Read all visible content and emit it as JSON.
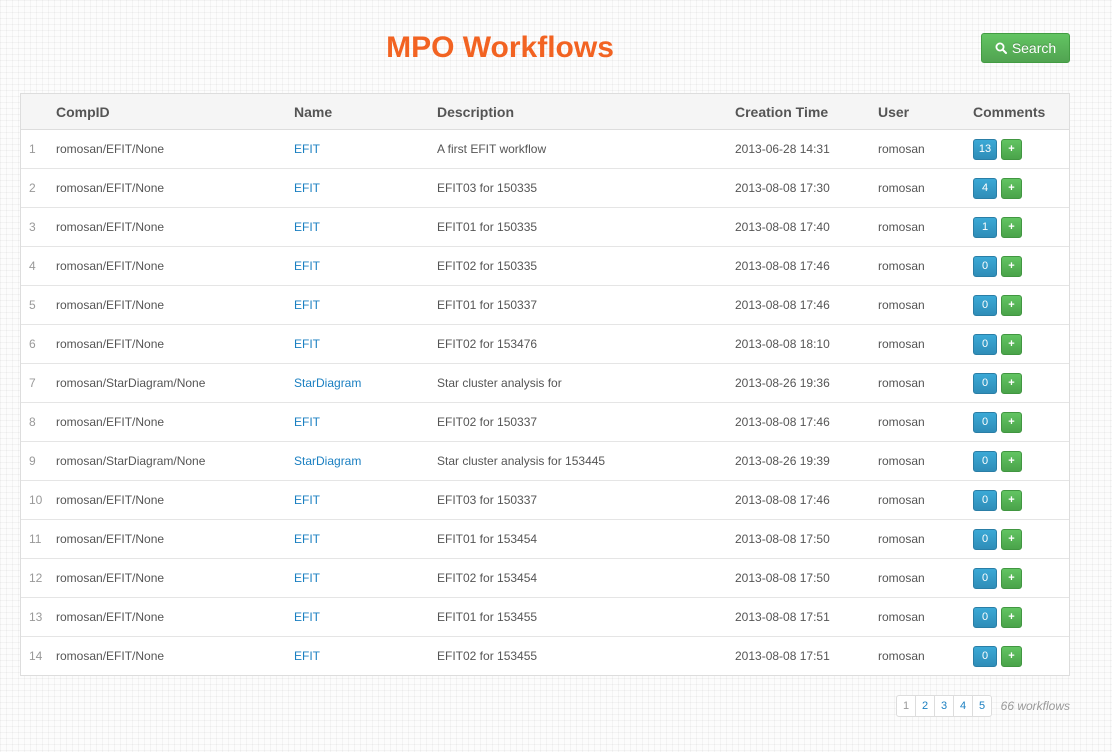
{
  "page": {
    "title": "MPO Workflows"
  },
  "toolbar": {
    "search_label": "Search",
    "search_icon": "search-icon"
  },
  "table": {
    "columns": [
      "",
      "CompID",
      "Name",
      "Description",
      "Creation Time",
      "User",
      "Comments"
    ],
    "rows": [
      {
        "index": "1",
        "compid": "romosan/EFIT/None",
        "name": "EFIT",
        "description": "A first EFIT workflow",
        "time": "2013-06-28 14:31",
        "user": "romosan",
        "comments": "13"
      },
      {
        "index": "2",
        "compid": "romosan/EFIT/None",
        "name": "EFIT",
        "description": "EFIT03 for 150335",
        "time": "2013-08-08 17:30",
        "user": "romosan",
        "comments": "4"
      },
      {
        "index": "3",
        "compid": "romosan/EFIT/None",
        "name": "EFIT",
        "description": "EFIT01 for 150335",
        "time": "2013-08-08 17:40",
        "user": "romosan",
        "comments": "1"
      },
      {
        "index": "4",
        "compid": "romosan/EFIT/None",
        "name": "EFIT",
        "description": "EFIT02 for 150335",
        "time": "2013-08-08 17:46",
        "user": "romosan",
        "comments": "0"
      },
      {
        "index": "5",
        "compid": "romosan/EFIT/None",
        "name": "EFIT",
        "description": "EFIT01 for 150337",
        "time": "2013-08-08 17:46",
        "user": "romosan",
        "comments": "0"
      },
      {
        "index": "6",
        "compid": "romosan/EFIT/None",
        "name": "EFIT",
        "description": "EFIT02 for 153476",
        "time": "2013-08-08 18:10",
        "user": "romosan",
        "comments": "0"
      },
      {
        "index": "7",
        "compid": "romosan/StarDiagram/None",
        "name": "StarDiagram",
        "description": "Star cluster analysis for",
        "time": "2013-08-26 19:36",
        "user": "romosan",
        "comments": "0"
      },
      {
        "index": "8",
        "compid": "romosan/EFIT/None",
        "name": "EFIT",
        "description": "EFIT02 for 150337",
        "time": "2013-08-08 17:46",
        "user": "romosan",
        "comments": "0"
      },
      {
        "index": "9",
        "compid": "romosan/StarDiagram/None",
        "name": "StarDiagram",
        "description": "Star cluster analysis for 153445",
        "time": "2013-08-26 19:39",
        "user": "romosan",
        "comments": "0"
      },
      {
        "index": "10",
        "compid": "romosan/EFIT/None",
        "name": "EFIT",
        "description": "EFIT03 for 150337",
        "time": "2013-08-08 17:46",
        "user": "romosan",
        "comments": "0"
      },
      {
        "index": "11",
        "compid": "romosan/EFIT/None",
        "name": "EFIT",
        "description": "EFIT01 for 153454",
        "time": "2013-08-08 17:50",
        "user": "romosan",
        "comments": "0"
      },
      {
        "index": "12",
        "compid": "romosan/EFIT/None",
        "name": "EFIT",
        "description": "EFIT02 for 153454",
        "time": "2013-08-08 17:50",
        "user": "romosan",
        "comments": "0"
      },
      {
        "index": "13",
        "compid": "romosan/EFIT/None",
        "name": "EFIT",
        "description": "EFIT01 for 153455",
        "time": "2013-08-08 17:51",
        "user": "romosan",
        "comments": "0"
      },
      {
        "index": "14",
        "compid": "romosan/EFIT/None",
        "name": "EFIT",
        "description": "EFIT02 for 153455",
        "time": "2013-08-08 17:51",
        "user": "romosan",
        "comments": "0"
      }
    ],
    "add_comment_label": "+"
  },
  "pagination": {
    "pages": [
      "1",
      "2",
      "3",
      "4",
      "5"
    ],
    "current": "1",
    "total": "66 workflows"
  },
  "colors": {
    "title": "#f26322",
    "link": "#1a7fc1",
    "search_button": "#5cb85c",
    "comment_badge": "#2f96c8",
    "add_button": "#5cb85c"
  }
}
